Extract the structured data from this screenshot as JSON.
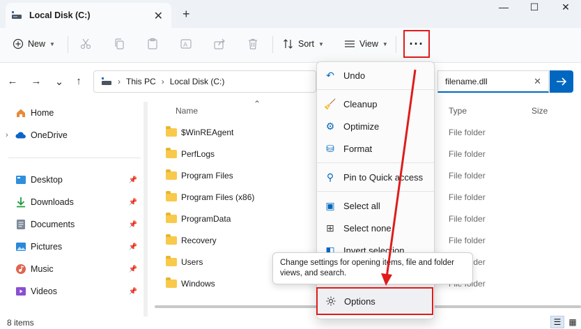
{
  "window": {
    "tab_title": "Local Disk (C:)",
    "close_tab": "✕",
    "new_tab": "+",
    "minimize": "—",
    "maximize": "☐",
    "close": "✕"
  },
  "toolbar": {
    "new_label": "New",
    "sort_label": "Sort",
    "view_label": "View",
    "more_label": "···"
  },
  "address": {
    "crumbs": [
      "This PC",
      "Local Disk (C:)"
    ],
    "search_value": "filename.dll"
  },
  "sidebar": {
    "items": [
      {
        "label": "Home",
        "icon": "home-icon"
      },
      {
        "label": "OneDrive",
        "icon": "cloud-icon"
      },
      {
        "label": "Desktop",
        "icon": "desktop-icon"
      },
      {
        "label": "Downloads",
        "icon": "download-icon"
      },
      {
        "label": "Documents",
        "icon": "documents-icon"
      },
      {
        "label": "Pictures",
        "icon": "pictures-icon"
      },
      {
        "label": "Music",
        "icon": "music-icon"
      },
      {
        "label": "Videos",
        "icon": "videos-icon"
      }
    ]
  },
  "columns": {
    "name": "Name",
    "type": "Type",
    "size": "Size"
  },
  "files": [
    {
      "name": "$WinREAgent",
      "type": "File folder"
    },
    {
      "name": "PerfLogs",
      "type": "File folder"
    },
    {
      "name": "Program Files",
      "type": "File folder"
    },
    {
      "name": "Program Files (x86)",
      "type": "File folder"
    },
    {
      "name": "ProgramData",
      "type": "File folder"
    },
    {
      "name": "Recovery",
      "type": "File folder"
    },
    {
      "name": "Users",
      "type": "File folder"
    },
    {
      "name": "Windows",
      "type": "File folder"
    }
  ],
  "menu": {
    "items": [
      "Undo",
      "Cleanup",
      "Optimize",
      "Format",
      "Pin to Quick access",
      "Select all",
      "Select none",
      "Invert selection"
    ],
    "options": "Options"
  },
  "tooltip": "Change settings for opening items, file and folder views, and search.",
  "status": {
    "count": "8 items"
  },
  "colors": {
    "accent": "#0067c0",
    "highlight_box": "#e01b1b",
    "folder": "#f8c94b"
  }
}
